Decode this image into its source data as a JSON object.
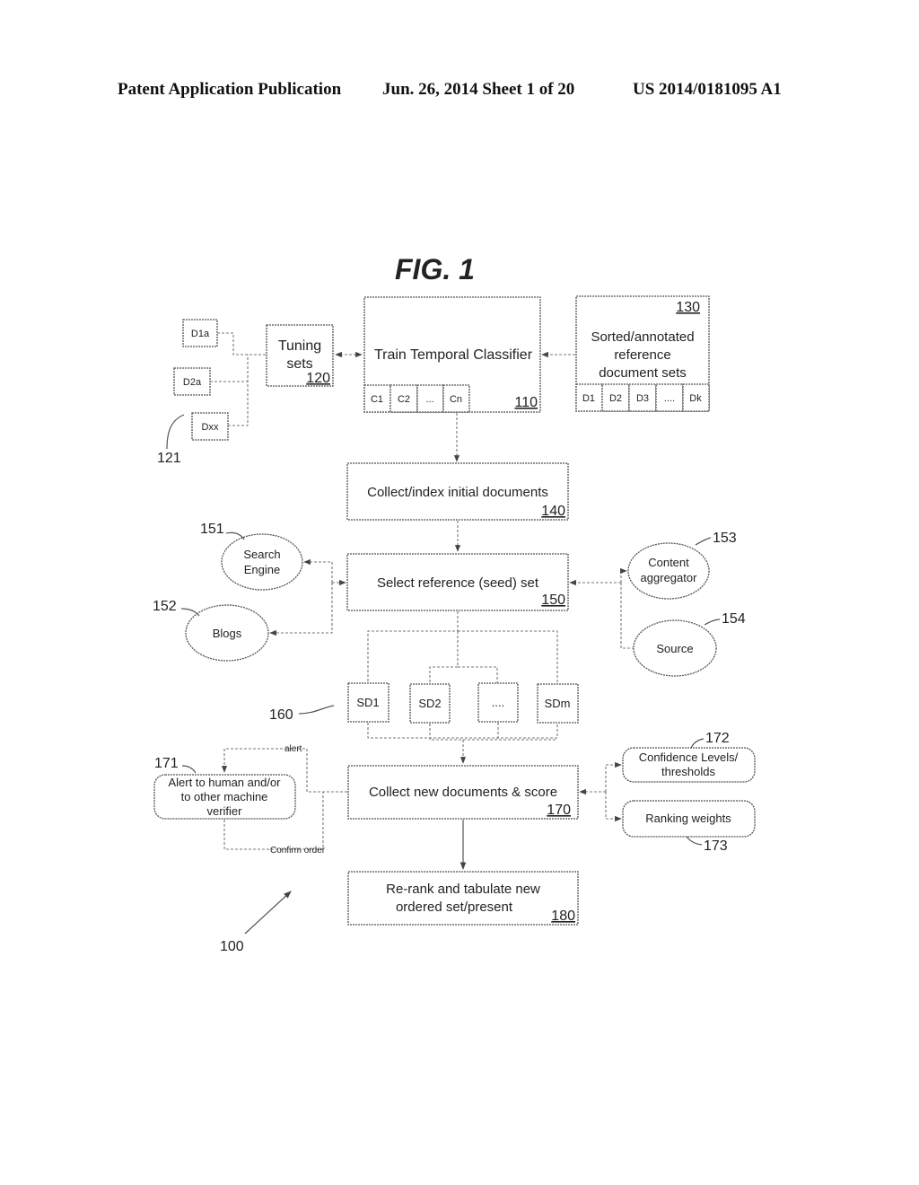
{
  "header": {
    "left": "Patent Application Publication",
    "middle": "Jun. 26, 2014  Sheet 1 of 20",
    "right": "US 2014/0181095 A1"
  },
  "figure": {
    "title": "FIG. 1",
    "ref_main": "100"
  },
  "tuning": {
    "docs": [
      "D1a",
      "D2a",
      "Dxx"
    ],
    "ref_docs": "121",
    "label_line1": "Tuning",
    "label_line2": "sets",
    "ref": "120"
  },
  "classifier": {
    "label": "Train Temporal Classifier",
    "ref": "110",
    "cells": [
      "C1",
      "C2",
      "...",
      "Cn"
    ]
  },
  "reference_sets": {
    "label_line1": "Sorted/annotated",
    "label_line2": "reference",
    "label_line3": "document sets",
    "ref": "130",
    "cells": [
      "D1",
      "D2",
      "D3",
      "....",
      "Dk"
    ]
  },
  "collect_initial": {
    "label": "Collect/index initial documents",
    "ref": "140"
  },
  "select_seed": {
    "label": "Select reference (seed) set",
    "ref": "150"
  },
  "sources": {
    "search_engine": {
      "line1": "Search",
      "line2": "Engine",
      "ref": "151"
    },
    "blogs": {
      "label": "Blogs",
      "ref": "152"
    },
    "content_aggregator": {
      "line1": "Content",
      "line2": "aggregator",
      "ref": "153"
    },
    "source": {
      "label": "Source",
      "ref": "154"
    }
  },
  "seed_docs": {
    "ref": "160",
    "items": [
      "SD1",
      "SD2",
      "....",
      "SDm"
    ]
  },
  "collect_new": {
    "label": "Collect new documents & score",
    "ref": "170"
  },
  "alert": {
    "line1": "Alert to human and/or",
    "line2": "to other machine",
    "line3": "verifier",
    "ref": "171",
    "alert_label": "alert",
    "confirm_label": "Confirm order"
  },
  "confidence": {
    "line1": "Confidence Levels/",
    "line2": "thresholds",
    "ref": "172"
  },
  "ranking": {
    "label": "Ranking weights",
    "ref": "173"
  },
  "rerank": {
    "line1": "Re-rank and tabulate new",
    "line2": "ordered set/present",
    "ref": "180"
  }
}
